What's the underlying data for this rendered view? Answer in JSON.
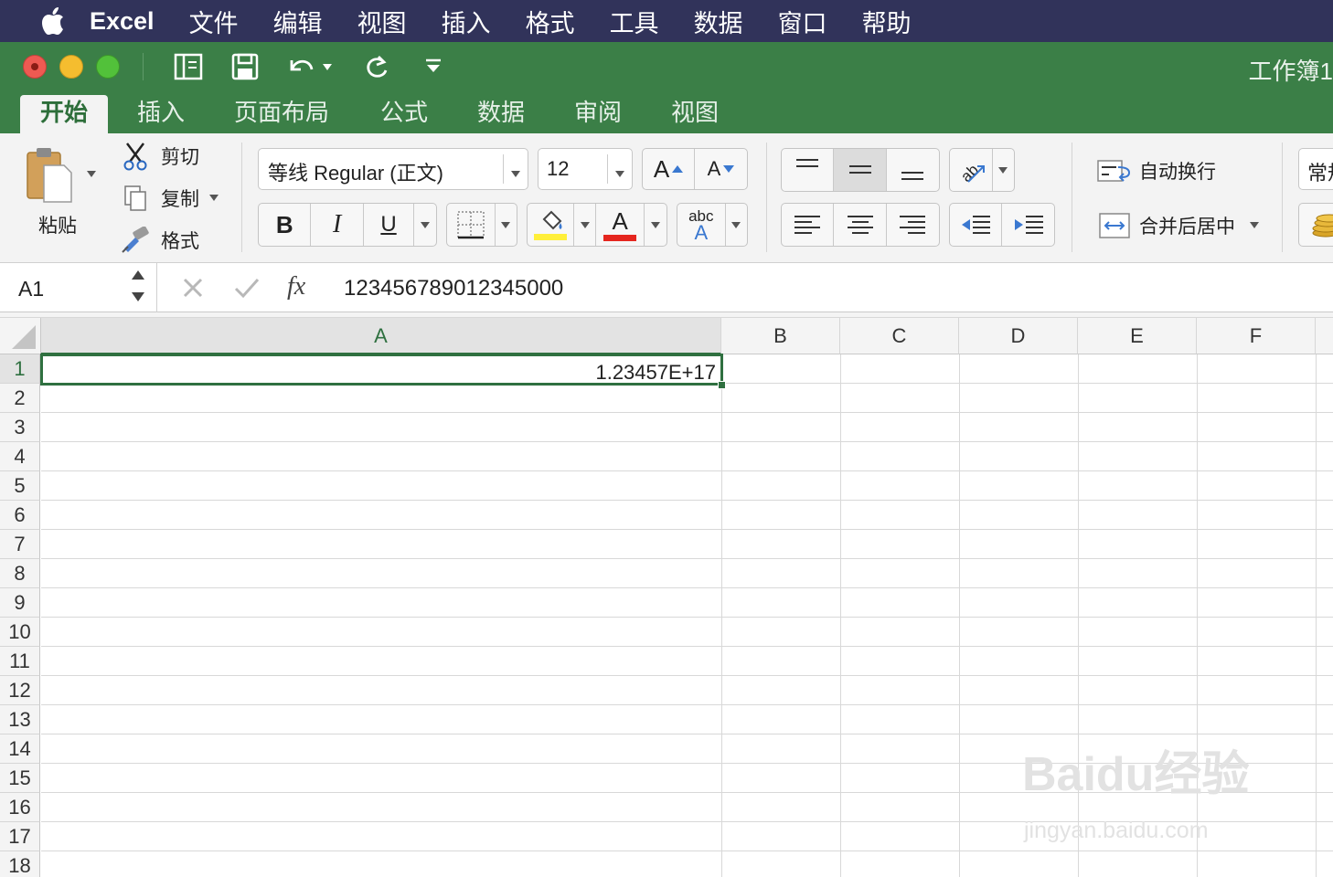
{
  "menubar": {
    "app_name": "Excel",
    "items": [
      "文件",
      "编辑",
      "视图",
      "插入",
      "格式",
      "工具",
      "数据",
      "窗口",
      "帮助"
    ]
  },
  "titlebar": {
    "doc_title": "工作簿1"
  },
  "tabs": [
    "开始",
    "插入",
    "页面布局",
    "公式",
    "数据",
    "审阅",
    "视图"
  ],
  "ribbon": {
    "paste_label": "粘贴",
    "cut_label": "剪切",
    "copy_label": "复制",
    "format_painter_label": "格式",
    "font_name": "等线 Regular (正文)",
    "font_size": "12",
    "grow_font": "A",
    "shrink_font": "A",
    "bold": "B",
    "italic": "I",
    "underline": "U",
    "font_color_letter": "A",
    "phonetic_top": "abc",
    "phonetic_bottom": "A",
    "wrap_text_label": "自动换行",
    "merge_center_label": "合并后居中",
    "number_format_partial": "常规",
    "fill_color": "#ffef3a",
    "font_color": "#e5261f"
  },
  "formula_bar": {
    "name_box": "A1",
    "fx": "fx",
    "content": "123456789012345000"
  },
  "sheet": {
    "columns": [
      "A",
      "B",
      "C",
      "D",
      "E",
      "F"
    ],
    "rows": [
      "1",
      "2",
      "3",
      "4",
      "5",
      "6",
      "7",
      "8",
      "9",
      "10",
      "11",
      "12",
      "13",
      "14",
      "15",
      "16",
      "17",
      "18"
    ],
    "cell_a1_display": "1.23457E+17"
  },
  "watermark": {
    "main": "Baidu经验",
    "sub": "jingyan.baidu.com"
  },
  "colors": {
    "menubar": "#31335a",
    "excel_green": "#3b7f47",
    "selection": "#2f7040"
  }
}
